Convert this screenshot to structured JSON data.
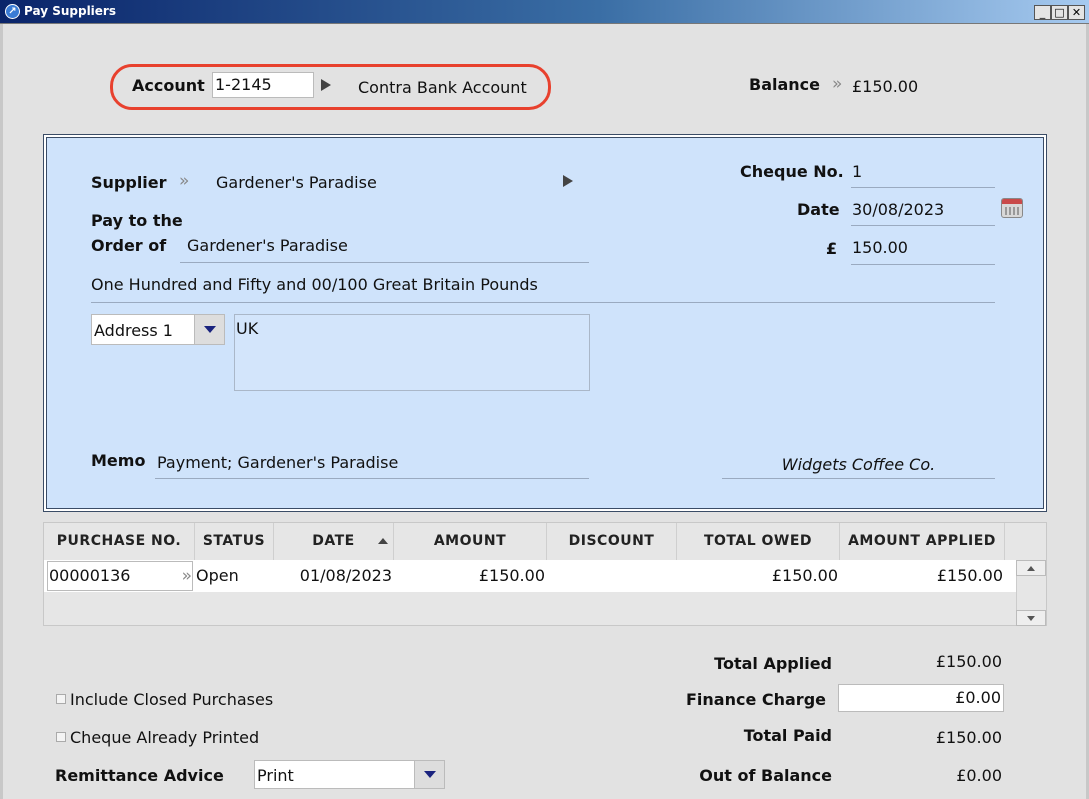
{
  "window": {
    "title": "Pay Suppliers",
    "icon": "app-icon"
  },
  "account": {
    "label": "Account",
    "value": "1-2145",
    "name": "Contra Bank Account"
  },
  "balance": {
    "label": "Balance",
    "value": "£150.00"
  },
  "cheque": {
    "supplier_label": "Supplier",
    "supplier": "Gardener's Paradise",
    "pay_to_line1": "Pay to the",
    "pay_to_line2": "Order of",
    "pay_to": "Gardener's Paradise",
    "amount_words": "One Hundred and Fifty and 00/100 Great Britain Pounds",
    "cheque_no_label": "Cheque No.",
    "cheque_no": "1",
    "date_label": "Date",
    "date": "30/08/2023",
    "currency_label": "£",
    "amount": "150.00",
    "address_select": "Address 1",
    "address": "UK",
    "memo_label": "Memo",
    "memo": "Payment; Gardener's Paradise",
    "company": "Widgets Coffee Co."
  },
  "table": {
    "headers": [
      "PURCHASE NO.",
      "STATUS",
      "DATE",
      "AMOUNT",
      "DISCOUNT",
      "TOTAL OWED",
      "AMOUNT APPLIED"
    ],
    "rows": [
      {
        "purchase_no": "00000136",
        "status": "Open",
        "date": "01/08/2023",
        "amount": "£150.00",
        "discount": "",
        "total_owed": "£150.00",
        "amount_applied": "£150.00"
      }
    ]
  },
  "options": {
    "include_closed": "Include Closed Purchases",
    "cheque_printed": "Cheque Already Printed",
    "remittance_label": "Remittance Advice",
    "remittance_value": "Print"
  },
  "totals": {
    "applied_label": "Total Applied",
    "applied": "£150.00",
    "finance_label": "Finance Charge",
    "finance": "£0.00",
    "paid_label": "Total Paid",
    "paid": "£150.00",
    "oob_label": "Out of Balance",
    "oob": "£0.00"
  },
  "colors": {
    "cheque_bg": "#cfe3fb",
    "highlight": "#e8412e",
    "titlebar": "#0a246a"
  }
}
